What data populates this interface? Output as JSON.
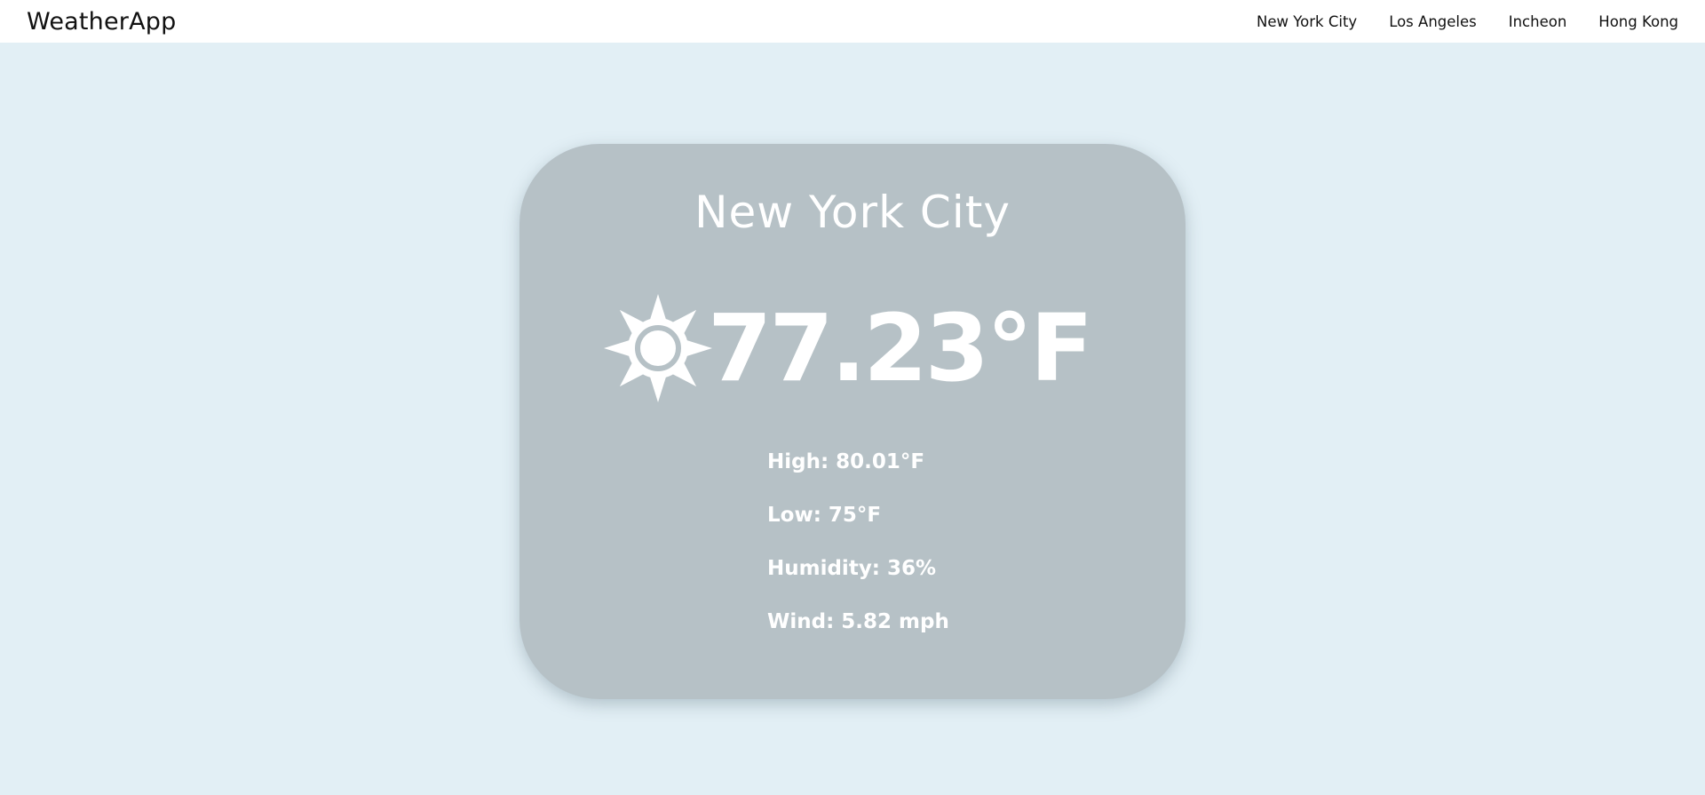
{
  "header": {
    "brand": "WeatherApp",
    "nav": [
      {
        "label": "New York City"
      },
      {
        "label": "Los Angeles"
      },
      {
        "label": "Incheon"
      },
      {
        "label": "Hong Kong"
      }
    ]
  },
  "card": {
    "city": "New York City",
    "icon": "sun-icon",
    "temperature": "77.23°F",
    "details": {
      "high": "High: 80.01°F",
      "low": "Low: 75°F",
      "humidity": "Humidity: 36%",
      "wind": "Wind: 5.82 mph"
    }
  },
  "colors": {
    "background": "#e2eff5",
    "card": "#b6c1c6",
    "text_on_card": "#ffffff"
  }
}
